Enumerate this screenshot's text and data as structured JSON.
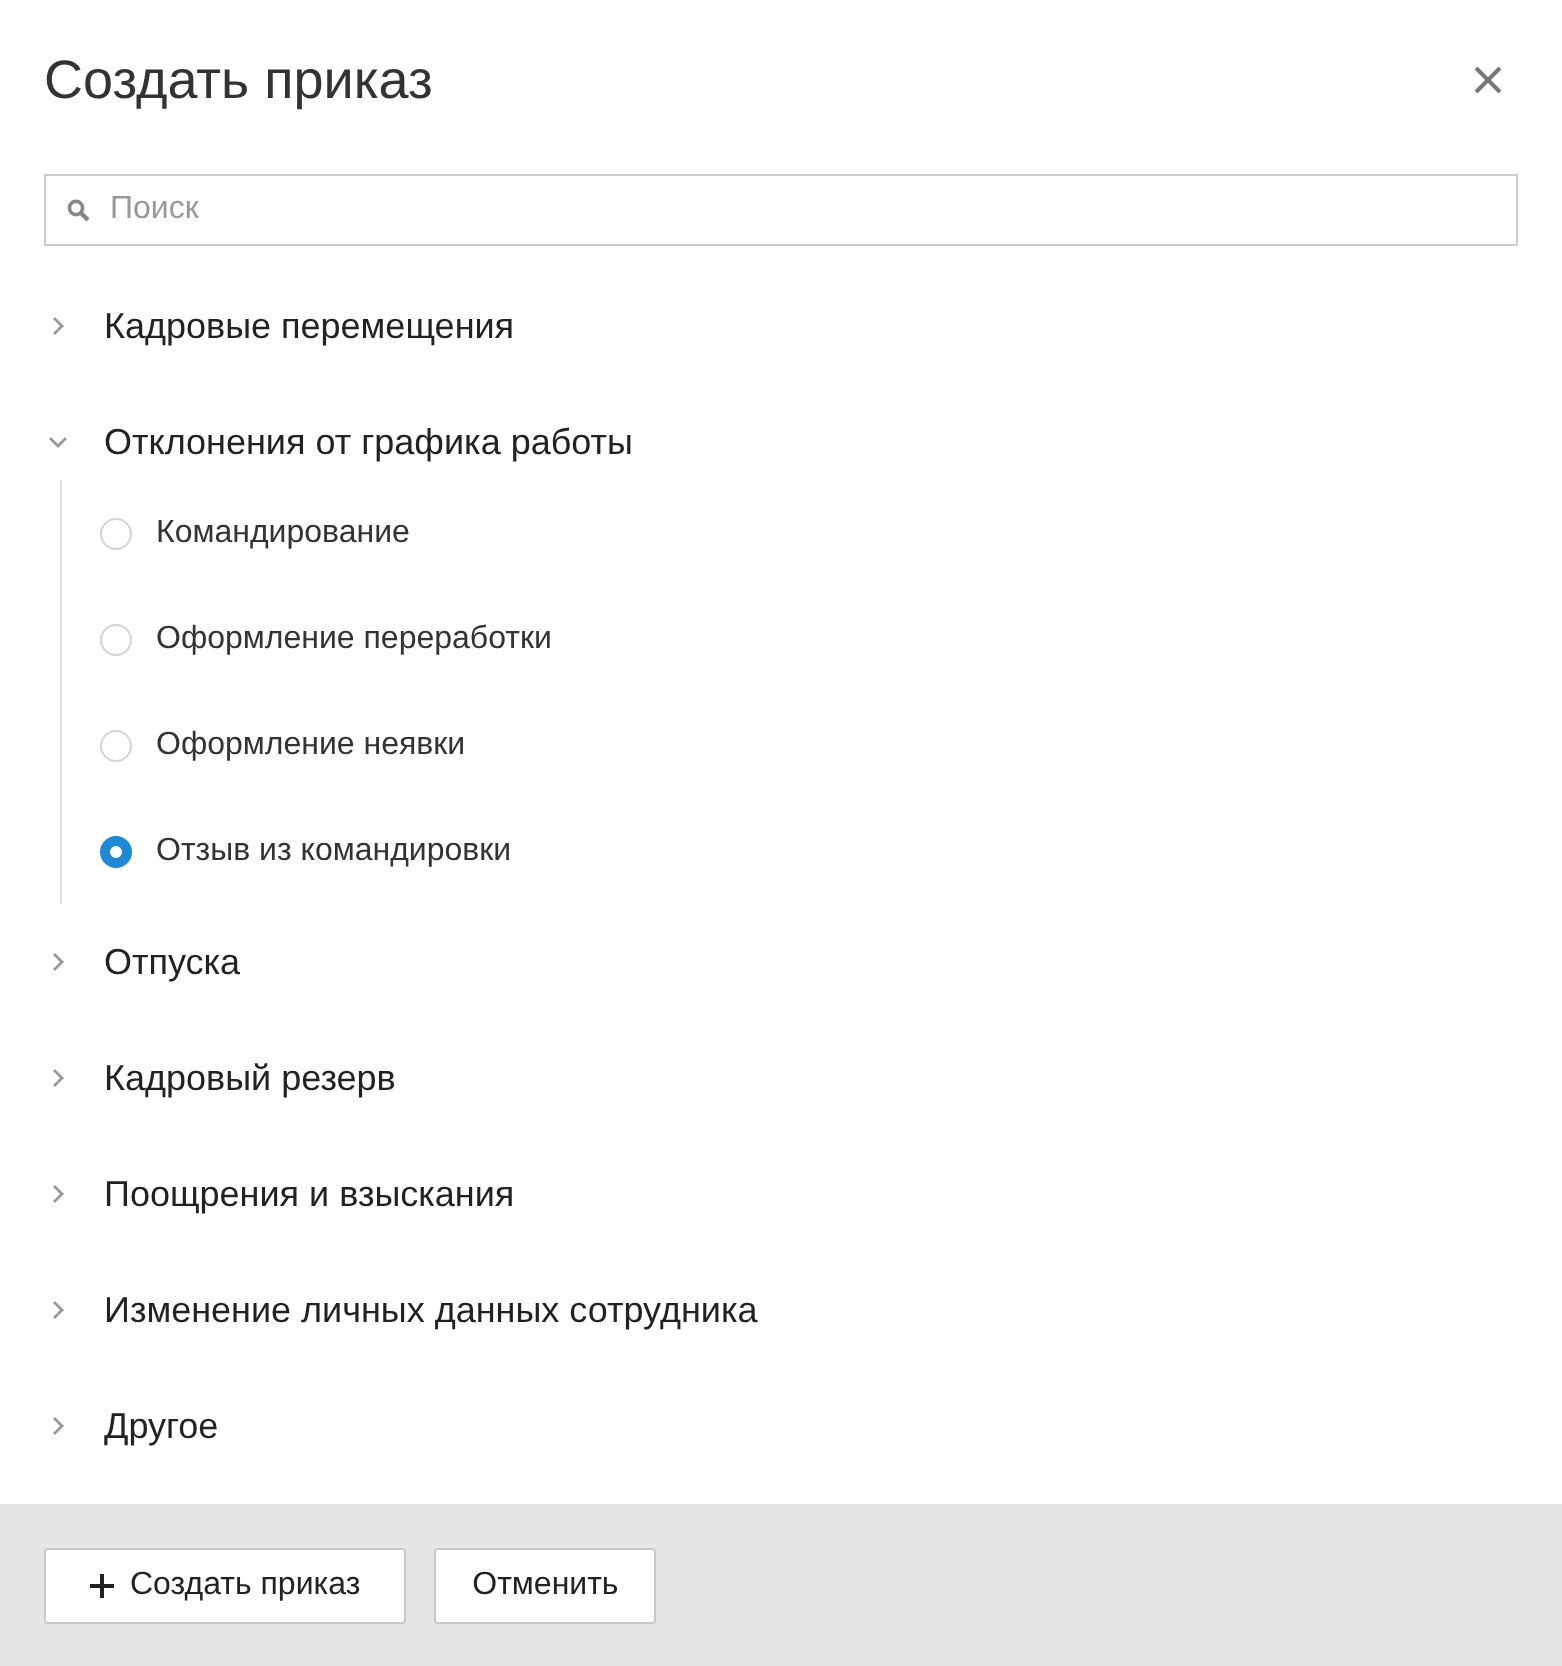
{
  "dialog": {
    "title": "Создать приказ"
  },
  "search": {
    "placeholder": "Поиск"
  },
  "groups": [
    {
      "label": "Кадровые перемещения",
      "expanded": false
    },
    {
      "label": "Отклонения от графика работы",
      "expanded": true,
      "children": [
        {
          "label": "Командирование",
          "selected": false
        },
        {
          "label": "Оформление переработки",
          "selected": false
        },
        {
          "label": "Оформление неявки",
          "selected": false
        },
        {
          "label": "Отзыв из командировки",
          "selected": true
        }
      ]
    },
    {
      "label": "Отпуска",
      "expanded": false
    },
    {
      "label": "Кадровый резерв",
      "expanded": false
    },
    {
      "label": "Поощрения и взыскания",
      "expanded": false
    },
    {
      "label": "Изменение личных данных сотрудника",
      "expanded": false
    },
    {
      "label": "Другое",
      "expanded": false
    }
  ],
  "buttons": [
    {
      "label": "Создать приказ",
      "kind": "create"
    },
    {
      "label": "Отменить",
      "kind": "cancel"
    }
  ]
}
